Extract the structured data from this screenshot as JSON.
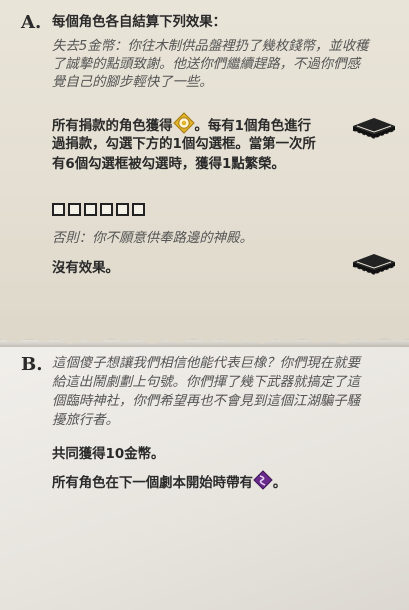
{
  "section_a": {
    "letter": "A.",
    "heading": "每個角色各自結算下列效果：",
    "flavor_lines": [
      "失去5金幣：你往木制供品盤裡扔了幾枚錢幣，並收穫",
      "了誠摯的點頭致謝。他送你們繼續趕路，不過你們感",
      "覺自己的腳步輕快了一些。"
    ],
    "rule_lines": [
      "所有捐款的角色獲得",
      "。每有1個角色進行",
      "過捐款，勾選下方的1個勾選框。當第一次所",
      "有6個勾選框被勾選時，獲得1點繁榮。"
    ],
    "checkbox_count": 6,
    "otherwise": "否則：你不願意供奉路邊的神殿。",
    "no_effect": "沒有效果。"
  },
  "section_b": {
    "letter": "B.",
    "flavor_lines": [
      "這個傻子想讓我們相信他能代表巨橡？你們現在就要",
      "給這出鬧劇劃上句號。你們揮了幾下武器就搞定了這",
      "個臨時神社，你們希望再也不會見到這個江湖騙子騷",
      "擾旅行者。"
    ],
    "reward_lines": [
      "共同獲得10金幣。",
      "所有角色在下一個劇本開始時帶有",
      "。"
    ]
  },
  "icons": {
    "bless": "bless-token-icon",
    "curse": "curse-card-icon",
    "card_stack": "card-stack-icon"
  },
  "colors": {
    "bless_gold": "#e3b32c",
    "curse_purple": "#6a2a8c",
    "text": "#2a2a2a"
  }
}
